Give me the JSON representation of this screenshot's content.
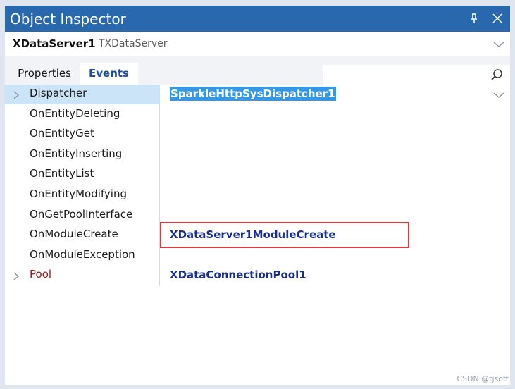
{
  "window": {
    "title": "Object Inspector",
    "pin_icon": "pin-icon",
    "close_icon": "close-icon"
  },
  "object_selector": {
    "name": "XDataServer1",
    "type": "TXDataServer",
    "dropdown_icon": "chevron-down-icon"
  },
  "tabs": [
    {
      "label": "Properties",
      "active": false
    },
    {
      "label": "Events",
      "active": true
    }
  ],
  "search": {
    "value": "",
    "icon": "search-icon"
  },
  "events": [
    {
      "name": "Dispatcher",
      "value": "SparkleHttpSysDispatcher1",
      "expandable": true,
      "selected": true
    },
    {
      "name": "OnEntityDeleting",
      "value": ""
    },
    {
      "name": "OnEntityGet",
      "value": ""
    },
    {
      "name": "OnEntityInserting",
      "value": ""
    },
    {
      "name": "OnEntityList",
      "value": ""
    },
    {
      "name": "OnEntityModifying",
      "value": ""
    },
    {
      "name": "OnGetPoolInterface",
      "value": ""
    },
    {
      "name": "OnModuleCreate",
      "value": "XDataServer1ModuleCreate",
      "highlighted": true
    },
    {
      "name": "OnModuleException",
      "value": ""
    },
    {
      "name": "Pool",
      "value": "XDataConnectionPool1",
      "expandable": true,
      "color": "#8b1a1a"
    }
  ],
  "watermark": "CSDN @tjsoft",
  "colors": {
    "titlebar": "#2a68ad",
    "selection": "#3399e6",
    "value_text": "#1a2f8a",
    "highlight_box": "#e0383b"
  }
}
